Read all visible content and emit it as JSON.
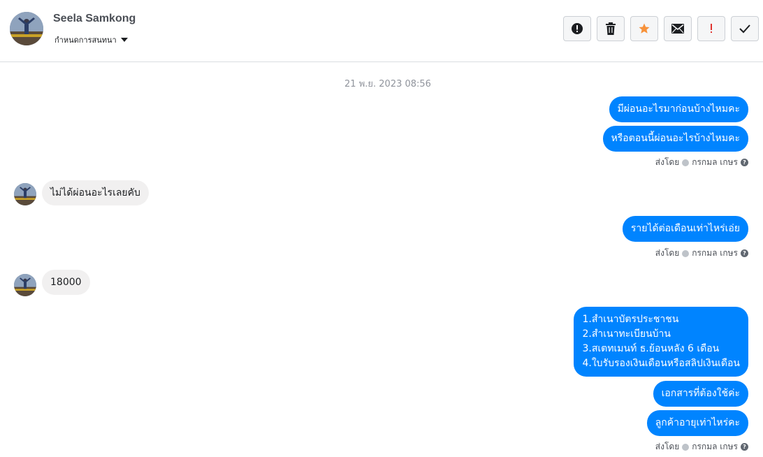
{
  "header": {
    "contact_name": "Seela Samkong",
    "assign_label": "กำหนดการสนทนา",
    "actions": [
      {
        "name": "mark-spam-button",
        "icon": "exclamation-circle-icon"
      },
      {
        "name": "delete-button",
        "icon": "trash-icon"
      },
      {
        "name": "star-button",
        "icon": "star-icon",
        "color": "#f7923b"
      },
      {
        "name": "mark-unread-button",
        "icon": "envelope-icon"
      },
      {
        "name": "mark-important-button",
        "icon": "exclamation-icon",
        "color": "#e0332f"
      },
      {
        "name": "mark-done-button",
        "icon": "check-icon"
      }
    ]
  },
  "thread": {
    "timestamp": "21 พ.ย. 2023 08:56",
    "messages": [
      {
        "dir": "out",
        "text": "มีผ่อนอะไรมาก่อนบ้างไหมคะ"
      },
      {
        "dir": "out",
        "text": "หรือตอนนี้ผ่อนอะไรบ้างไหมคะ"
      },
      {
        "dir": "in",
        "text": "ไม่ได้ผ่อนอะไรเลยคับ"
      },
      {
        "dir": "out",
        "text": "รายได้ต่อเดือนเท่าไหร่เอ่ย"
      },
      {
        "dir": "in",
        "text": "18000"
      },
      {
        "dir": "out",
        "text": "1.สำเนาบัตรประชาชน\n2.สำเนาทะเบียนบ้าน\n3.สเตทเมนท์ ธ.ย้อนหลัง 6 เดือน\n4.ใบรับรองเงินเดือนหรือสลิปเงินเดือน"
      },
      {
        "dir": "out",
        "text": "เอกสารที่ต้องใช้ค่ะ"
      },
      {
        "dir": "out",
        "text": "ลูกค้าอายุเท่าไหร่คะ"
      }
    ],
    "sent_by_prefix": "ส่งโดย",
    "sent_by_name": "กรกมล เกษร"
  },
  "colors": {
    "outgoing_bubble": "#0084ff",
    "incoming_bubble": "#f1f0f0"
  }
}
